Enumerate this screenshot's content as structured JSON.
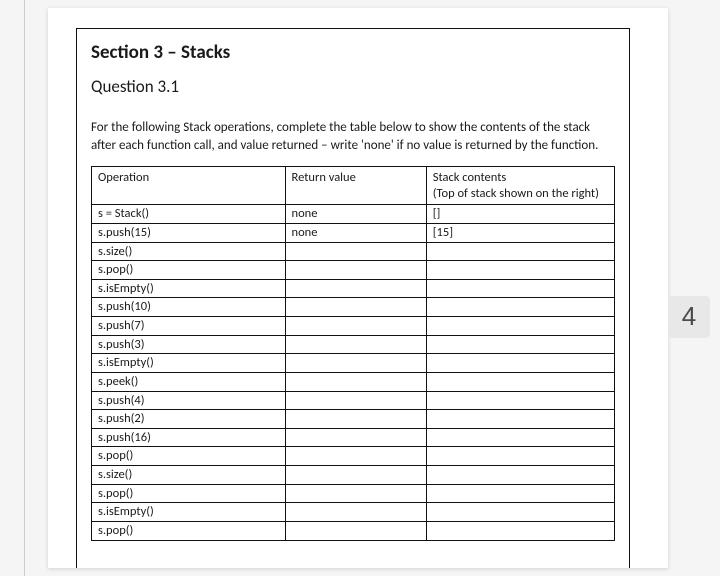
{
  "page_number": "4",
  "section_heading": "Section 3 – Stacks",
  "question_heading": "Question 3.1",
  "instructions": "For the following Stack operations, complete the table below to show the contents of the stack after each function call, and value returned – write 'none' if no value is returned by the function.",
  "table": {
    "headers": {
      "col1": "Operation",
      "col2": "Return value",
      "col3": "Stack contents\n(Top of stack shown on the right)"
    },
    "rows": [
      {
        "op": "s = Stack()",
        "ret": "none",
        "stack": "[]"
      },
      {
        "op": "s.push(15)",
        "ret": "none",
        "stack": "[15]"
      },
      {
        "op": "s.size()",
        "ret": "",
        "stack": ""
      },
      {
        "op": "s.pop()",
        "ret": "",
        "stack": ""
      },
      {
        "op": "s.isEmpty()",
        "ret": "",
        "stack": ""
      },
      {
        "op": "s.push(10)",
        "ret": "",
        "stack": ""
      },
      {
        "op": "s.push(7)",
        "ret": "",
        "stack": ""
      },
      {
        "op": "s.push(3)",
        "ret": "",
        "stack": ""
      },
      {
        "op": "s.isEmpty()",
        "ret": "",
        "stack": ""
      },
      {
        "op": "s.peek()",
        "ret": "",
        "stack": ""
      },
      {
        "op": "s.push(4)",
        "ret": "",
        "stack": ""
      },
      {
        "op": "s.push(2)",
        "ret": "",
        "stack": ""
      },
      {
        "op": "s.push(16)",
        "ret": "",
        "stack": ""
      },
      {
        "op": "s.pop()",
        "ret": "",
        "stack": ""
      },
      {
        "op": "s.size()",
        "ret": "",
        "stack": ""
      },
      {
        "op": "s.pop()",
        "ret": "",
        "stack": ""
      },
      {
        "op": "s.isEmpty()",
        "ret": "",
        "stack": ""
      },
      {
        "op": "s.pop()",
        "ret": "",
        "stack": ""
      }
    ]
  }
}
